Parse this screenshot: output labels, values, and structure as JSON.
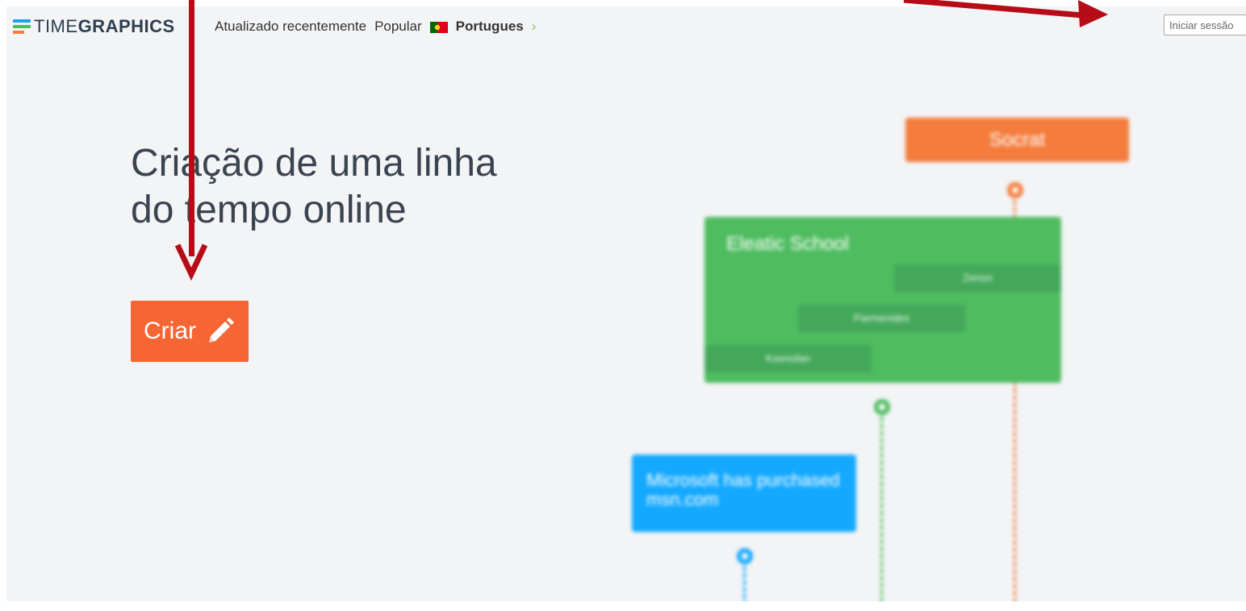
{
  "header": {
    "logo_prefix": "TIME",
    "logo_bold": "GRAPHICS",
    "nav_recent": "Atualizado recentemente",
    "nav_popular": "Popular",
    "language": "Portugues",
    "chevron": "›",
    "login_placeholder": "Iniciar sessão"
  },
  "hero": {
    "title_line1": "Criação de uma linha",
    "title_line2": "do tempo online",
    "create_label": "Criar",
    "create_icon": "pencil-icon"
  },
  "timeline": {
    "events": [
      {
        "title": "Socrat",
        "color": "#f47c3c"
      },
      {
        "title": "Eleatic School",
        "color": "#4fbc60",
        "children": [
          "Zenon",
          "Parmenides",
          "Ksenofan"
        ]
      },
      {
        "title": "Microsoft has purchased msn.com",
        "color": "#14a8ff"
      }
    ]
  },
  "colors": {
    "accent": "#f56634",
    "annotation": "#b50c18",
    "logo_blue": "#1da1f2",
    "logo_green": "#4fbc60",
    "logo_orange": "#f47c3c"
  }
}
